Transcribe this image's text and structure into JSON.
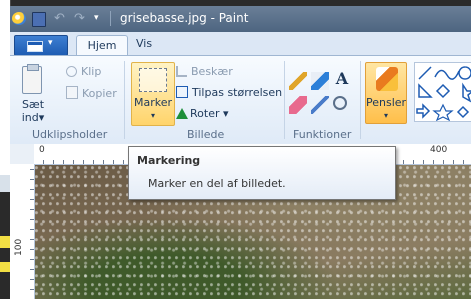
{
  "window": {
    "title": "grisebasse.jpg - Paint",
    "quick_access_dropdown": "▾",
    "undo_glyph": "↶",
    "redo_glyph": "↷"
  },
  "menu": {
    "arrow": "▾"
  },
  "tabs": [
    {
      "label": "Hjem",
      "selected": true
    },
    {
      "label": "Vis",
      "selected": false
    }
  ],
  "ribbon": {
    "clipboard": {
      "group_label": "Udklipsholder",
      "paste_label_line1": "Sæt",
      "paste_label_line2": "ind",
      "paste_arrow": "▾",
      "cut_label": "Klip",
      "copy_label": "Kopier"
    },
    "image": {
      "group_label": "Billede",
      "select_label": "Marker",
      "select_arrow": "▾",
      "crop_label": "Beskær",
      "resize_label": "Tilpas størrelsen",
      "rotate_label": "Roter",
      "rotate_arrow": "▾"
    },
    "tools": {
      "group_label": "Funktioner",
      "text_glyph": "A"
    },
    "brushes": {
      "label": "Pensler",
      "arrow": "▾"
    }
  },
  "ruler": {
    "top_zero": "0",
    "top_400": "400",
    "left_100": "100"
  },
  "tooltip": {
    "title": "Markering",
    "body": "Marker en del af billedet."
  },
  "colors": {
    "accent": "#1e5cb3",
    "selected_button": "#ffd46b",
    "ribbon_bg": "#dfeaf7"
  }
}
